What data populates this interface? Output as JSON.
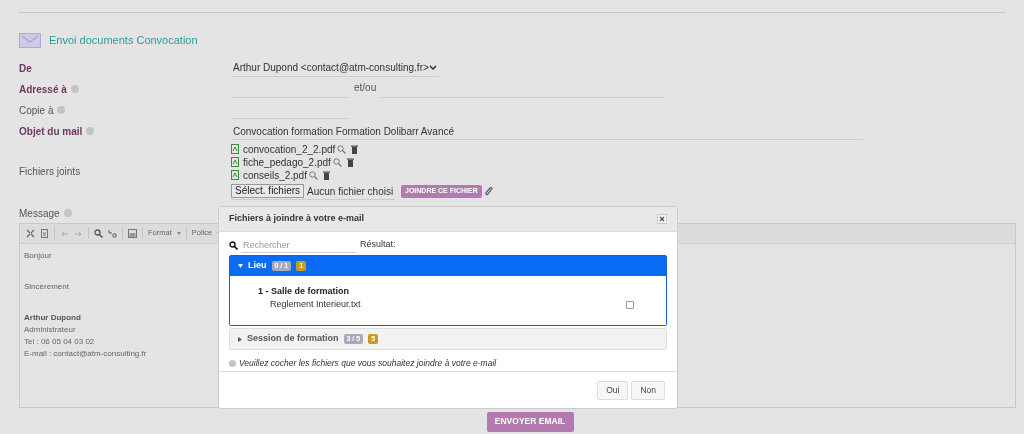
{
  "header": {
    "title": "Envoi documents Convocation"
  },
  "form": {
    "fields": [
      {
        "kind": "select",
        "label": "De",
        "required": true,
        "info": false,
        "value": "Arthur Dupond <contact@atm-consulting.fr>"
      },
      {
        "kind": "double",
        "label": "Adressé à",
        "required": true,
        "info": true,
        "separator": "et/ou"
      },
      {
        "kind": "text",
        "label": "Copie à",
        "required": false,
        "info": true
      },
      {
        "kind": "wide",
        "label": "Objet du mail",
        "required": true,
        "info": true,
        "value": "Convocation formation Formation Dolibarr Avancé"
      }
    ],
    "attachments": {
      "label": "Fichiers joints",
      "files": [
        "convocation_2_2.pdf",
        "fiche_pedago_2.pdf",
        "conseils_2.pdf"
      ],
      "choose_button": "Sélect. fichiers",
      "no_file": "Aucun fichier choisi",
      "attach_button": "JOINDRE CE FICHIER"
    },
    "message": {
      "label": "Message",
      "info": true,
      "toolbar": [
        {
          "kind": "icon"
        },
        {
          "kind": "icon"
        },
        {
          "kind": "sep"
        },
        {
          "kind": "icon"
        },
        {
          "kind": "icon"
        },
        {
          "kind": "sep"
        },
        {
          "kind": "icon"
        },
        {
          "kind": "icon"
        },
        {
          "kind": "sep"
        },
        {
          "kind": "icon"
        },
        {
          "kind": "sep"
        },
        {
          "kind": "dropdown",
          "label": "Format"
        },
        {
          "kind": "sep"
        },
        {
          "kind": "dropdown",
          "label": "Police"
        }
      ],
      "paragraphs": [
        [
          {
            "text": "Bonjour",
            "bold": false
          }
        ],
        [
          {
            "text": "Sincèrement",
            "bold": false
          }
        ],
        [
          {
            "text": "Arthur Dupond",
            "bold": true
          },
          {
            "text": "Administrateur",
            "bold": false
          },
          {
            "text": "Tel : 06 05 04 03 02",
            "bold": false
          },
          {
            "text": "E-mail : contact@atm-consulting.fr",
            "bold": false
          }
        ]
      ]
    },
    "send_button": "ENVOYER EMAIL"
  },
  "modal": {
    "title": "Fichiers à joindre à votre e-mail",
    "search_placeholder": "Rechercher",
    "result_label": "Résultat:",
    "groups": [
      {
        "name": "Lieu",
        "count": "0 / 1",
        "total": "1",
        "expanded": true,
        "children": [
          {
            "title": "1 - Salle de formation",
            "files": [
              {
                "name": "Reglement Interieur.txt",
                "checked": false
              }
            ]
          }
        ]
      },
      {
        "name": "Session de formation",
        "count": "3 / 5",
        "total": "5",
        "expanded": false
      }
    ],
    "note": "Veuillez cocher les fichiers que vous souhaitez joindre à votre e-mail",
    "buttons": [
      "Oui",
      "Non"
    ]
  }
}
